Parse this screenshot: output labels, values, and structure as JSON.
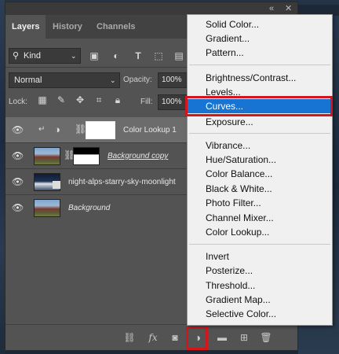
{
  "tabs": [
    "Layers",
    "History",
    "Channels"
  ],
  "filter": {
    "kind_label": "Kind"
  },
  "blend": {
    "mode": "Normal",
    "opacity_label": "Opacity:",
    "opacity_value": "100%"
  },
  "lock": {
    "label": "Lock:",
    "fill_label": "Fill:",
    "fill_value": "100%"
  },
  "layers": [
    {
      "name": "Color Lookup 1",
      "selected": true
    },
    {
      "name": "Background copy",
      "selected": false
    },
    {
      "name": "night-alps-starry-sky-moonlight",
      "selected": false
    },
    {
      "name": "Background",
      "selected": false
    }
  ],
  "menu": {
    "group1": [
      "Solid Color...",
      "Gradient...",
      "Pattern..."
    ],
    "group2": [
      "Brightness/Contrast...",
      "Levels...",
      "Curves...",
      "Exposure..."
    ],
    "group3": [
      "Vibrance...",
      "Hue/Saturation...",
      "Color Balance...",
      "Black & White...",
      "Photo Filter...",
      "Channel Mixer...",
      "Color Lookup..."
    ],
    "group4": [
      "Invert",
      "Posterize...",
      "Threshold...",
      "Gradient Map...",
      "Selective Color..."
    ],
    "hovered": "Curves..."
  },
  "colors": {
    "menu_highlight": "#1874d3",
    "annotation_red": "#d3161c"
  },
  "icons": {
    "filter_row": [
      "search-icon",
      "image-filter-icon",
      "adjustment-filter-icon",
      "type-filter-icon",
      "shape-filter-icon"
    ],
    "lock_row": [
      "lock-pixels-icon",
      "brush-lock-icon",
      "move-lock-icon",
      "artboard-lock-icon",
      "padlock-icon"
    ],
    "bottom": [
      "link-layers-icon",
      "fx-icon",
      "mask-icon",
      "adjustment-layer-icon",
      "folder-icon",
      "new-layer-icon",
      "trash-icon"
    ]
  }
}
